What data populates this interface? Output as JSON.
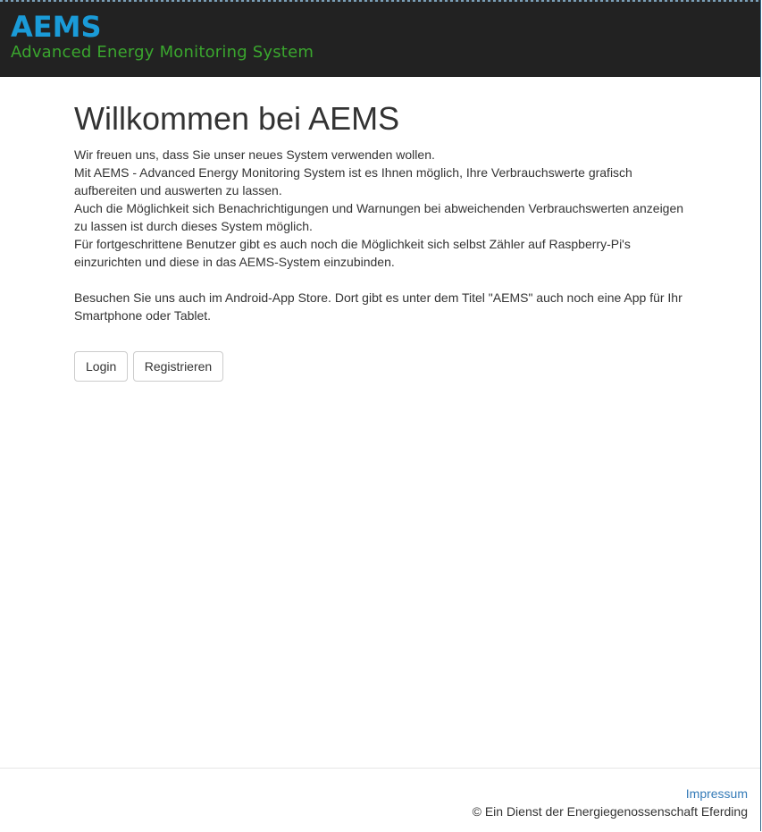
{
  "header": {
    "brand_name": "AEMS",
    "brand_subtitle": "Advanced Energy Monitoring System"
  },
  "main": {
    "title": "Willkommen bei AEMS",
    "paragraph_lines": [
      "Wir freuen uns, dass Sie unser neues System verwenden wollen.",
      "Mit AEMS - Advanced Energy Monitoring System ist es Ihnen möglich, Ihre Verbrauchswerte grafisch",
      "aufbereiten und auswerten zu lassen.",
      "Auch die Möglichkeit sich Benachrichtigungen und Warnungen bei abweichenden Verbrauchswerten anzeigen",
      "zu lassen ist durch dieses System möglich.",
      "Für fortgeschrittene Benutzer gibt es auch noch die Möglichkeit sich selbst Zähler auf Raspberry-Pi's",
      "einzurichten und diese in das AEMS-System einzubinden."
    ],
    "app_lines": [
      "Besuchen Sie uns auch im Android-App Store. Dort gibt es unter dem Titel \"AEMS\" auch noch eine App für Ihr",
      "Smartphone oder Tablet."
    ],
    "login_label": "Login",
    "register_label": "Registrieren"
  },
  "footer": {
    "impressum_label": "Impressum",
    "copyright": "© Ein Dienst der Energiegenossenschaft Eferding"
  },
  "colors": {
    "navbar_bg": "#222222",
    "brand_blue": "#1a9bd8",
    "brand_green": "#3aa62e",
    "link": "#337ab7"
  }
}
